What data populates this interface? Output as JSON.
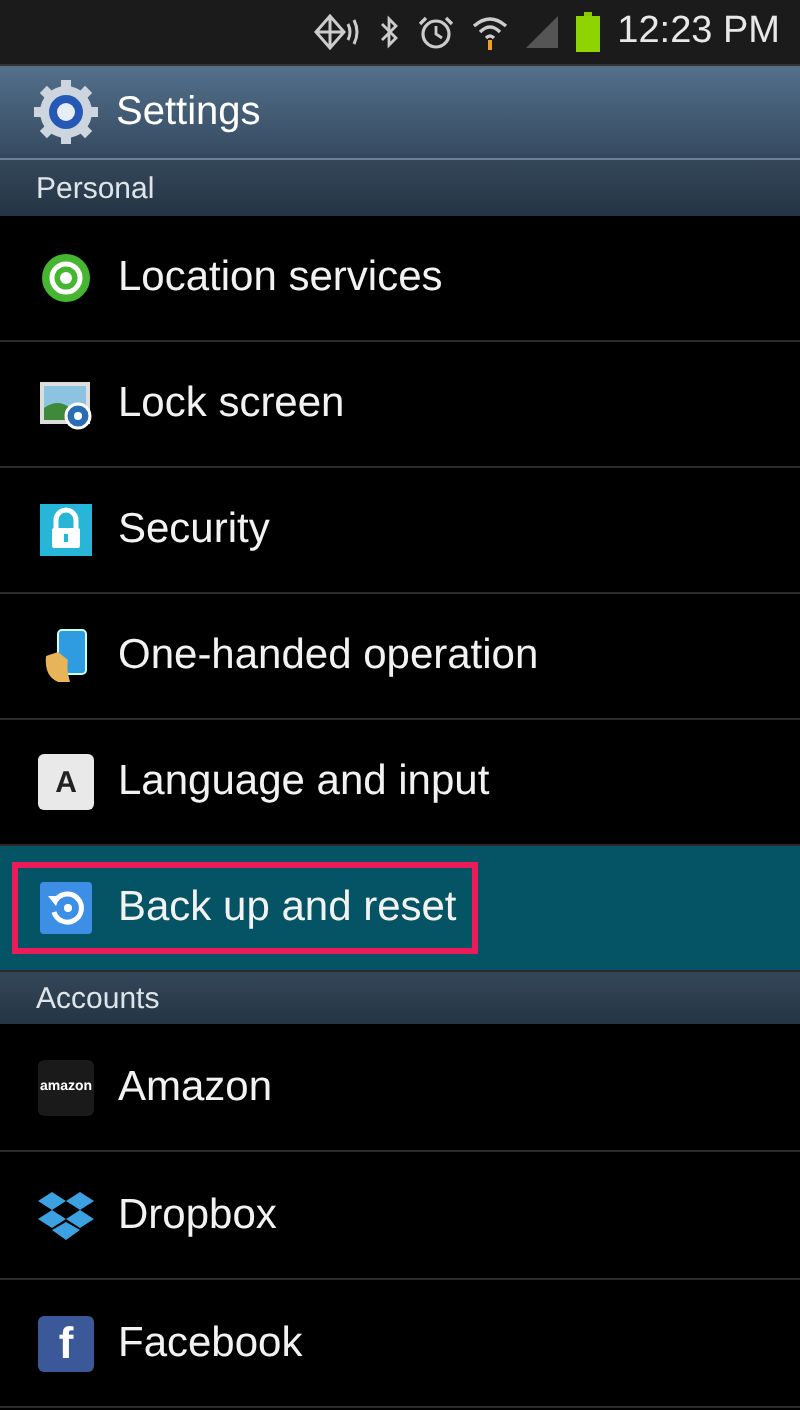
{
  "status_bar": {
    "time": "12:23 PM"
  },
  "app_bar": {
    "title": "Settings"
  },
  "sections": [
    {
      "header": "Personal",
      "items": [
        {
          "label": "Location services",
          "kind": "location",
          "selected": false,
          "highlighted": false
        },
        {
          "label": "Lock screen",
          "kind": "lockscreen",
          "selected": false,
          "highlighted": false
        },
        {
          "label": "Security",
          "kind": "security",
          "selected": false,
          "highlighted": false
        },
        {
          "label": "One-handed operation",
          "kind": "onehand",
          "selected": false,
          "highlighted": false
        },
        {
          "label": "Language and input",
          "kind": "language",
          "icon_text": "A",
          "selected": false,
          "highlighted": false
        },
        {
          "label": "Back up and reset",
          "kind": "backup",
          "selected": true,
          "highlighted": true
        }
      ]
    },
    {
      "header": "Accounts",
      "items": [
        {
          "label": "Amazon",
          "kind": "amazon",
          "icon_text": "amazon",
          "selected": false,
          "highlighted": false
        },
        {
          "label": "Dropbox",
          "kind": "dropbox",
          "selected": false,
          "highlighted": false
        },
        {
          "label": "Facebook",
          "kind": "facebook",
          "icon_text": "f",
          "selected": false,
          "highlighted": false
        }
      ]
    }
  ]
}
